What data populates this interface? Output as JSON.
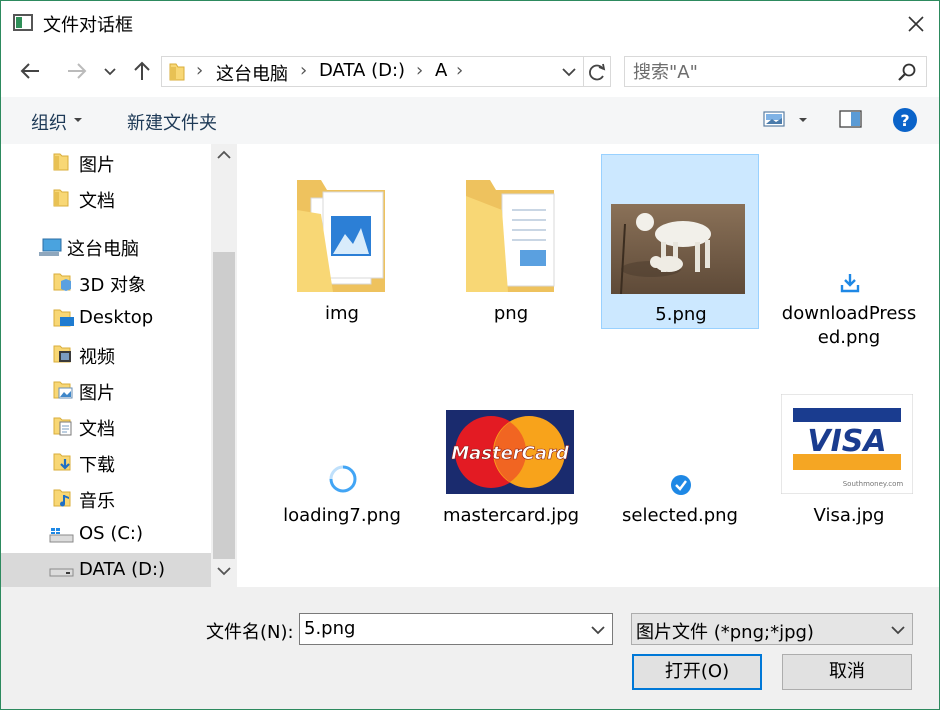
{
  "window": {
    "title": "文件对话框"
  },
  "nav": {
    "back": "back-arrow-icon",
    "forward": "forward-arrow-icon",
    "recent": "chevron-down-icon",
    "up": "up-arrow-icon"
  },
  "address": {
    "breadcrumb": [
      "这台电脑",
      "DATA (D:)",
      "A"
    ],
    "separator": "›"
  },
  "search": {
    "placeholder": "搜索\"A\""
  },
  "toolbar": {
    "organize": "组织",
    "new_folder": "新建文件夹"
  },
  "sidebar": {
    "items": [
      {
        "label": "图片",
        "icon": "folder-icon"
      },
      {
        "label": "文档",
        "icon": "folder-icon"
      },
      {
        "label": "这台电脑",
        "icon": "computer-icon"
      },
      {
        "label": "3D 对象",
        "icon": "3d-objects-folder-icon"
      },
      {
        "label": "Desktop",
        "icon": "desktop-folder-icon"
      },
      {
        "label": "视频",
        "icon": "videos-folder-icon"
      },
      {
        "label": "图片",
        "icon": "pictures-folder-icon"
      },
      {
        "label": "文档",
        "icon": "documents-folder-icon"
      },
      {
        "label": "下载",
        "icon": "downloads-folder-icon"
      },
      {
        "label": "音乐",
        "icon": "music-folder-icon"
      },
      {
        "label": "OS (C:)",
        "icon": "windows-drive-icon"
      },
      {
        "label": "DATA (D:)",
        "icon": "drive-icon",
        "selected": true
      }
    ]
  },
  "files": [
    {
      "name": "img",
      "kind": "folder",
      "icon": "pictures-folder-icon"
    },
    {
      "name": "png",
      "kind": "folder",
      "icon": "folder-icon"
    },
    {
      "name": "5.png",
      "kind": "image",
      "icon": "goat-photo-thumbnail",
      "selected": true
    },
    {
      "name": "downloadPressed.png",
      "line1": "downloadPress",
      "line2": "ed.png",
      "kind": "image",
      "icon": "download-icon"
    },
    {
      "name": "loading7.png",
      "kind": "image",
      "icon": "loading-spinner-icon"
    },
    {
      "name": "mastercard.jpg",
      "kind": "image",
      "icon": "mastercard-logo"
    },
    {
      "name": "selected.png",
      "kind": "image",
      "icon": "check-circle-icon"
    },
    {
      "name": "Visa.jpg",
      "kind": "image",
      "icon": "visa-logo"
    }
  ],
  "logos": {
    "mastercard": "MasterCard",
    "visa": "VISA",
    "watermark": "Southmoney.com"
  },
  "bottom": {
    "filename_label": "文件名(N):",
    "filename_value": "5.png",
    "filetype": "图片文件 (*png;*jpg)",
    "open": "打开(O)",
    "cancel": "取消"
  },
  "colors": {
    "accent": "#0078d7",
    "selection": "#cce8ff",
    "folder": "#f8d775",
    "border": "#2d8a5e"
  }
}
